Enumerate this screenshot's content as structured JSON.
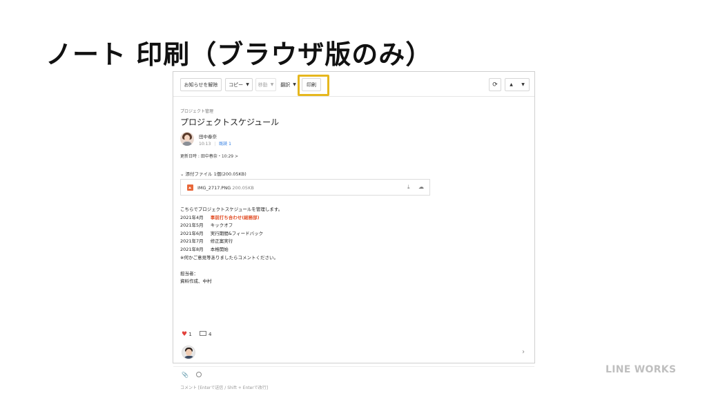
{
  "slide": {
    "title": "ノート 印刷（ブラウザ版のみ）",
    "brand": "LINE WORKS"
  },
  "toolbar": {
    "notice_label": "お知らせを解除",
    "copy_label": "コピー",
    "move_label": "移動",
    "translate_label": "翻訳",
    "print_label": "印刷",
    "refresh_icon": "⟳",
    "up_icon": "▲",
    "down_icon": "▼",
    "caret_icon": "▼",
    "highlight_color": "#e6b71e"
  },
  "note": {
    "breadcrumb": "プロジェクト管理",
    "title": "プロジェクトスケジュール",
    "author_name": "田中春奈",
    "author_time": "10:13",
    "author_sep": "|",
    "read_label": "既読 1",
    "updated": "更新日時 : 田中春奈・10:29 >"
  },
  "attachments": {
    "header": "⌄ 添付ファイル 1個(200.05KB)",
    "file_name": "IMG_2717.PNG",
    "file_size": "200.05KB",
    "download_icon": "⤓",
    "cloud_icon": "☁"
  },
  "body": {
    "intro": "こちらでプロジェクトスケジュールを管理します。",
    "rows": [
      {
        "month": "2021年4月",
        "task": "事前打ち合わせ(総務部)"
      },
      {
        "month": "2021年5月",
        "task": "キックオフ"
      },
      {
        "month": "2021年6月",
        "task": "実行期間&フィードバック"
      },
      {
        "month": "2021年7月",
        "task": "修正案実行"
      },
      {
        "month": "2021年8月",
        "task": "本格開始"
      }
    ],
    "note_line": "※何かご意見等ありましたらコメントください。",
    "owner_label": "担当者：",
    "owner_value": "資料作成、中村",
    "highlight_color": "#e2512a"
  },
  "reactions": {
    "like_icon": "♥",
    "like_count": "1",
    "comment_count": "4"
  },
  "comment": {
    "chevron": "›",
    "attach_icon": "📎",
    "placeholder": "コメント [Enterで送信 / Shift + Enterで改行]"
  }
}
